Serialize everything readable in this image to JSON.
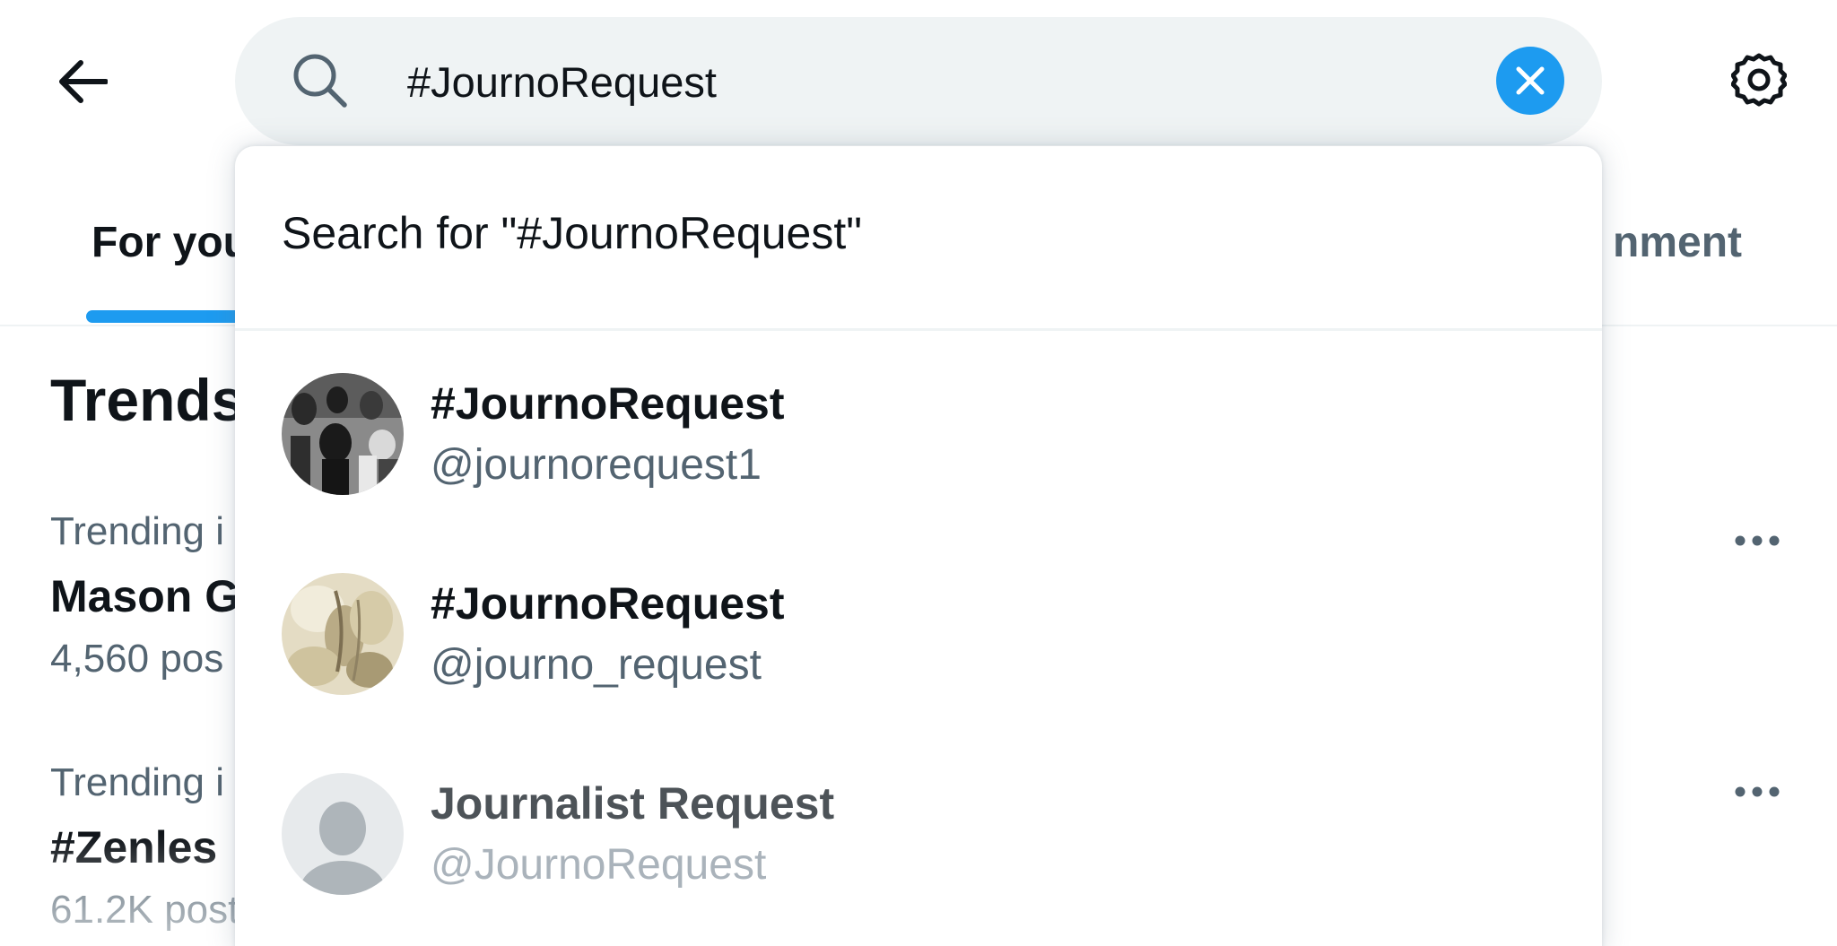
{
  "search": {
    "query": "#JournoRequest",
    "clear_label": "Clear search"
  },
  "header": {
    "back_icon": "arrow-left-icon",
    "settings_icon": "gear-icon"
  },
  "tabs": [
    {
      "label": "For you",
      "active": true
    },
    {
      "label": "nment",
      "active": false
    }
  ],
  "trends": {
    "title": "Trends",
    "items": [
      {
        "meta": "Trending i",
        "name": "Mason G",
        "count": "4,560 pos"
      },
      {
        "meta": "Trending i",
        "name": "#Zenles",
        "count": "61.2K post"
      }
    ]
  },
  "dropdown": {
    "search_for": "Search for \"#JournoRequest\"",
    "users": [
      {
        "name": "#JournoRequest",
        "handle": "@journorequest1",
        "avatar": "photo-crowd-bw"
      },
      {
        "name": "#JournoRequest",
        "handle": "@journo_request",
        "avatar": "photo-beige"
      },
      {
        "name": "Journalist Request",
        "handle": "@JournoRequest",
        "avatar": "default-avatar"
      }
    ]
  },
  "colors": {
    "accent": "#1d9bf0",
    "text_primary": "#0f1419",
    "text_secondary": "#536471",
    "search_bg": "#eff3f4"
  }
}
